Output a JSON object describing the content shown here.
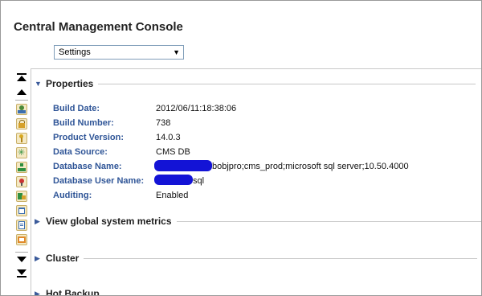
{
  "app": {
    "title": "Central Management Console"
  },
  "view_select": {
    "value": "Settings"
  },
  "sections": {
    "properties": {
      "label": "Properties"
    },
    "global_metrics": {
      "label": "View global system metrics"
    },
    "cluster": {
      "label": "Cluster"
    },
    "hot_backup": {
      "label": "Hot Backup"
    }
  },
  "properties": [
    {
      "label": "Build Date:",
      "value": "2012/06/11:18:38:06"
    },
    {
      "label": "Build Number:",
      "value": "738"
    },
    {
      "label": "Product Version:",
      "value": "14.0.3"
    },
    {
      "label": "Data Source:",
      "value": "CMS DB"
    },
    {
      "label": "Database Name:",
      "value": "bobjpro;cms_prod;microsoft sql server;10.50.4000"
    },
    {
      "label": "Database User Name:",
      "value": "sql"
    },
    {
      "label": "Auditing:",
      "value": "Enabled"
    }
  ],
  "toolbar_icons": [
    "scroll-top-icon",
    "scroll-up-icon",
    "users-icon",
    "lock-icon",
    "key-icon",
    "star-icon",
    "tree-icon",
    "pin-icon",
    "server-icon",
    "calendar-icon",
    "document-icon",
    "window-icon",
    "scroll-down-icon",
    "scroll-bottom-icon"
  ],
  "colors": {
    "label_blue": "#2f5597",
    "redaction": "#1313d6",
    "icon_fill": "#f4e9c4"
  }
}
